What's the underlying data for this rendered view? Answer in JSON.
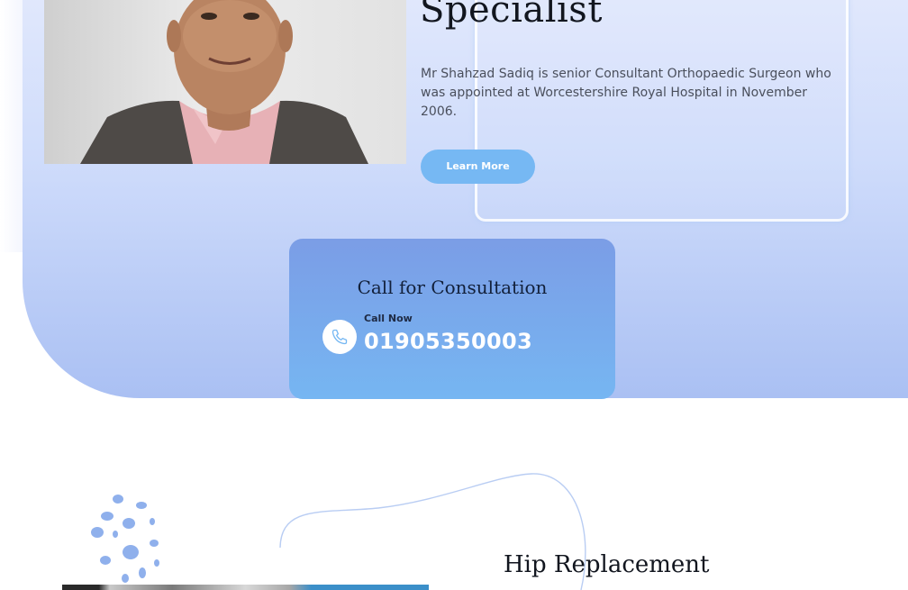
{
  "hero": {
    "title": "Specialist",
    "description": "Mr Shahzad Sadiq is senior Consultant Orthopaedic Surgeon who was appointed at Worcestershire Royal Hospital in November 2006.",
    "learn_more_label": "Learn More"
  },
  "consultation": {
    "title": "Call for Consultation",
    "call_label": "Call Now",
    "phone": "01905350003",
    "icon": "phone-icon"
  },
  "section": {
    "title": "Hip Replacement"
  },
  "colors": {
    "accent": "#76b8f3",
    "card_top": "#7b9de6",
    "card_bottom": "#76b6f2",
    "hero_bg": "#cfdcfb"
  }
}
